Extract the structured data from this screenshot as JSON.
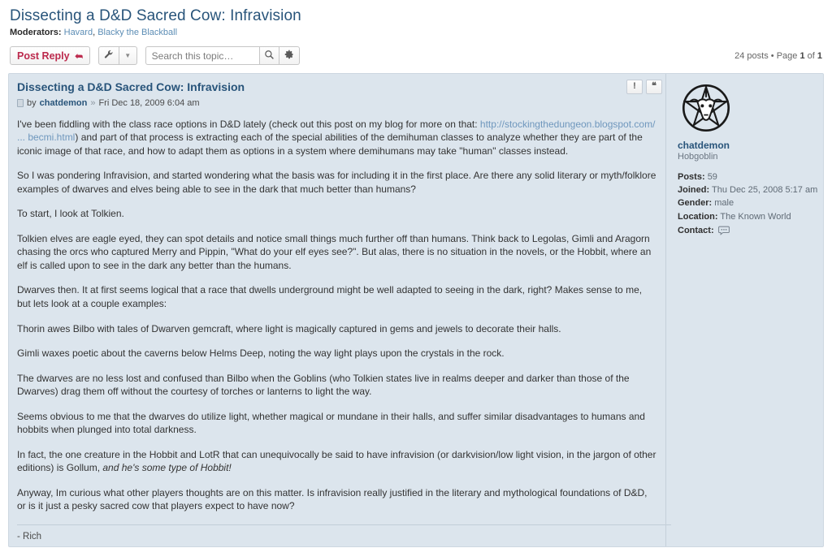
{
  "header": {
    "topic_title": "Dissecting a D&D Sacred Cow: Infravision",
    "moderators_label": "Moderators:",
    "moderators": [
      "Havard",
      "Blacky the Blackball"
    ],
    "moderators_text": "Havard, Blacky the Blackball"
  },
  "toolbar": {
    "post_reply_label": "Post Reply",
    "post_reply_icon": "reply-arrow-icon",
    "tools_icon": "wrench-icon",
    "tools_caret_icon": "chevron-down-icon",
    "search_placeholder": "Search this topic…",
    "search_value": "",
    "search_icon": "magnifier-icon",
    "search_options_icon": "gear-icon",
    "pagination": "24 posts • Page 1 of 1",
    "pagination_posts": "24 posts",
    "pagination_page": "Page 1 of 1"
  },
  "post": {
    "subject": "Dissecting a D&D Sacred Cow: Infravision",
    "byline_by": "by",
    "author": "chatdemon",
    "byline_sep": "»",
    "date": "Fri Dec 18, 2009 6:04 am",
    "report_button_label": "!",
    "quote_button_label": "❝",
    "paragraphs": [
      {
        "id": "p1",
        "pre": "I've been fiddling with the class race options in D&D lately (check out this post on my blog for more on that: ",
        "link": "http://stockingthedungeon.blogspot.com/ ... becmi.html",
        "post": ") and part of that process is extracting each of the special abilities of the demihuman classes to analyze whether they are part of the iconic image of that race, and how to adapt them as options in a system where demihumans may take \"human\" classes instead."
      },
      {
        "id": "p2",
        "text": "So I was pondering Infravision, and started wondering what the basis was for including it in the first place. Are there any solid literary or myth/folklore examples of dwarves and elves being able to see in the dark that much better than humans?"
      },
      {
        "id": "p3",
        "text": "To start, I look at Tolkien."
      },
      {
        "id": "p4",
        "text": "Tolkien elves are eagle eyed, they can spot details and notice small things much further off than humans. Think back to Legolas, Gimli and Aragorn chasing the orcs who captured Merry and Pippin, \"What do your elf eyes see?\". But alas, there is no situation in the novels, or the Hobbit, where an elf is called upon to see in the dark any better than the humans."
      },
      {
        "id": "p5",
        "text": "Dwarves then. It at first seems logical that a race that dwells underground might be well adapted to seeing in the dark, right? Makes sense to me, but lets look at a couple examples:"
      },
      {
        "id": "p6",
        "text": "Thorin awes Bilbo with tales of Dwarven gemcraft, where light is magically captured in gems and jewels to decorate their halls."
      },
      {
        "id": "p7",
        "text": "Gimli waxes poetic about the caverns below Helms Deep, noting the way light plays upon the crystals in the rock."
      },
      {
        "id": "p8",
        "text": "The dwarves are no less lost and confused than Bilbo when the Goblins (who Tolkien states live in realms deeper and darker than those of the Dwarves) drag them off without the courtesy of torches or lanterns to light the way."
      },
      {
        "id": "p9",
        "text": "Seems obvious to me that the dwarves do utilize light, whether magical or mundane in their halls, and suffer similar disadvantages to humans and hobbits when plunged into total darkness."
      },
      {
        "id": "p10",
        "pre": "In fact, the one creature in the Hobbit and LotR that can unequivocally be said to have infravision (or darkvision/low light vision, in the jargon of other editions) is Gollum, ",
        "italic": "and he's some type of Hobbit!",
        "post": ""
      },
      {
        "id": "p11",
        "text": "Anyway, Im curious what other players thoughts are on this matter. Is infravision really justified in the literary and mythological foundations of D&D, or is it just a pesky sacred cow that players expect to have now?"
      }
    ],
    "signature": "- Rich"
  },
  "profile": {
    "avatar_icon": "pentagram-goat-sigil-avatar",
    "username": "chatdemon",
    "rank": "Hobgoblin",
    "fields": [
      {
        "key": "Posts:",
        "value": "59"
      },
      {
        "key": "Joined:",
        "value": "Thu Dec 25, 2008 5:17 am"
      },
      {
        "key": "Gender:",
        "value": "male"
      },
      {
        "key": "Location:",
        "value": "The Known World"
      }
    ],
    "contact_label": "Contact:",
    "contact_icon": "private-message-icon"
  },
  "colors": {
    "link": "#28547a",
    "post_bg": "#dce5ed",
    "accent_red": "#bc2a4d",
    "body_text": "#333333"
  }
}
